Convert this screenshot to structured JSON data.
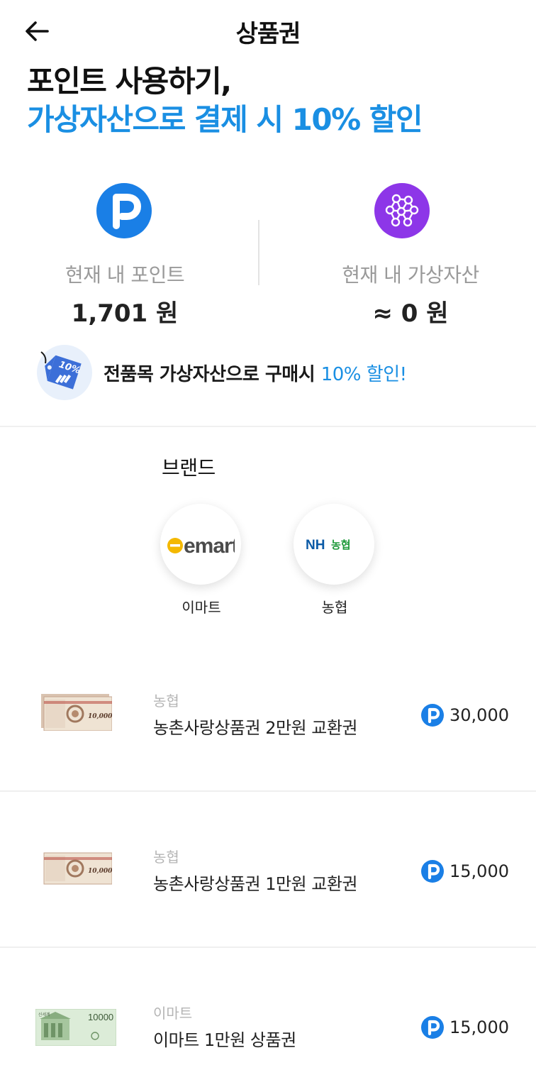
{
  "header": {
    "title": "상품권",
    "back_icon": "arrow-left-icon"
  },
  "hero": {
    "line1": "포인트 사용하기,",
    "line2": "가상자산으로 결제 시 10% 할인"
  },
  "balances": {
    "points": {
      "label": "현재 내 포인트",
      "value": "1,701 원",
      "icon": "point-p-icon",
      "color": "#1a7fe6"
    },
    "assets": {
      "label": "현재 내 가상자산",
      "value": "≈ 0 원",
      "icon": "network-nodes-icon",
      "color": "#8d36e8"
    }
  },
  "promo": {
    "text": "전품목 가상자산으로 구매시",
    "accent": "10% 할인!",
    "badge": "10%",
    "icon": "discount-tag-icon"
  },
  "brands": {
    "title": "브랜드",
    "items": [
      {
        "name": "이마트",
        "logo_text": "emart"
      },
      {
        "name": "농협",
        "logo_text_a": "NH",
        "logo_text_b": "농협"
      }
    ]
  },
  "products": [
    {
      "brand": "농협",
      "name": "농촌사랑상품권 2만원 교환권",
      "price": "30,000",
      "thumb_value": "10,000"
    },
    {
      "brand": "농협",
      "name": "농촌사랑상품권 1만원 교환권",
      "price": "15,000",
      "thumb_value": "10,000"
    },
    {
      "brand": "이마트",
      "name": "이마트 1만원 상품권",
      "price": "15,000",
      "thumb_value": "10000"
    }
  ],
  "colors": {
    "accent": "#1a8fe3",
    "point_blue": "#1a7fe6",
    "asset_purple": "#8d36e8"
  }
}
